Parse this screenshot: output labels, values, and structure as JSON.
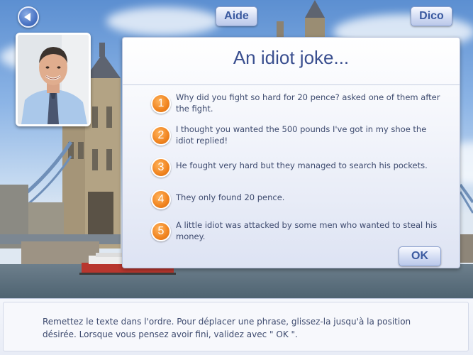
{
  "topbar": {
    "back_icon": "back-arrow-icon",
    "help_label": "Aide",
    "dico_label": "Dico"
  },
  "avatar": {
    "icon": "teacher-portrait"
  },
  "panel": {
    "title": "An idiot joke...",
    "sentences": [
      {
        "number": "1",
        "text": "Why did you fight so hard for 20 pence? asked one of them after the fight."
      },
      {
        "number": "2",
        "text": "I thought you wanted the 500 pounds I've got in my shoe the idiot replied!"
      },
      {
        "number": "3",
        "text": "He fought very hard but they managed to search his pockets."
      },
      {
        "number": "4",
        "text": "They only found 20 pence."
      },
      {
        "number": "5",
        "text": "A little idiot was attacked by some men who wanted to steal his money."
      }
    ],
    "ok_label": "OK"
  },
  "instructions": {
    "text": "Remettez le texte dans l'ordre. Pour déplacer une phrase, glissez-la jusqu'à la position désirée. Lorsque vous pensez avoir fini, validez avec \" OK \"."
  },
  "colors": {
    "accent_orange": "#f0831e",
    "title_blue": "#3a4f8f",
    "button_text": "#3b5aa0"
  }
}
